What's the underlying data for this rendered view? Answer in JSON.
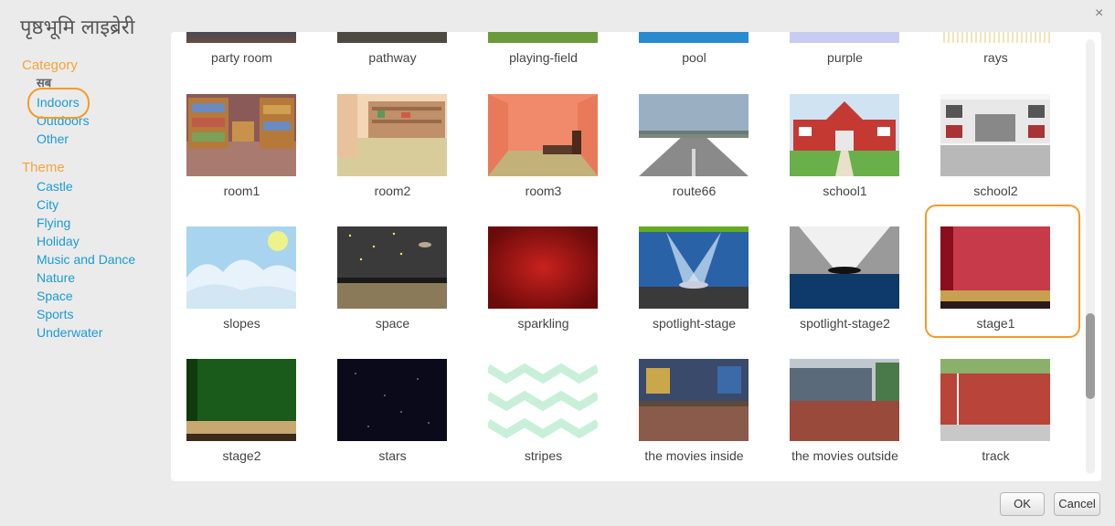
{
  "dialog": {
    "title": "पृष्ठभूमि लाइब्रेरी",
    "close_glyph": "×"
  },
  "sidebar": {
    "category_title": "Category",
    "category_items": [
      "सब",
      "Indoors",
      "Outdoors",
      "Other"
    ],
    "theme_title": "Theme",
    "theme_items": [
      "Castle",
      "City",
      "Flying",
      "Holiday",
      "Music and Dance",
      "Nature",
      "Space",
      "Sports",
      "Underwater"
    ]
  },
  "top_row": [
    "party room",
    "pathway",
    "playing-field",
    "pool",
    "purple",
    "rays"
  ],
  "rows": [
    [
      "room1",
      "room2",
      "room3",
      "route66",
      "school1",
      "school2"
    ],
    [
      "slopes",
      "space",
      "sparkling",
      "spotlight-stage",
      "spotlight-stage2",
      "stage1"
    ],
    [
      "stage2",
      "stars",
      "stripes",
      "the movies inside",
      "the movies outside",
      "track"
    ]
  ],
  "selected": "stage1",
  "buttons": {
    "ok": "OK",
    "cancel": "Cancel"
  },
  "colors": {
    "accent": "#f59b25",
    "link": "#1a9ad6",
    "section": "#f7a33a"
  }
}
